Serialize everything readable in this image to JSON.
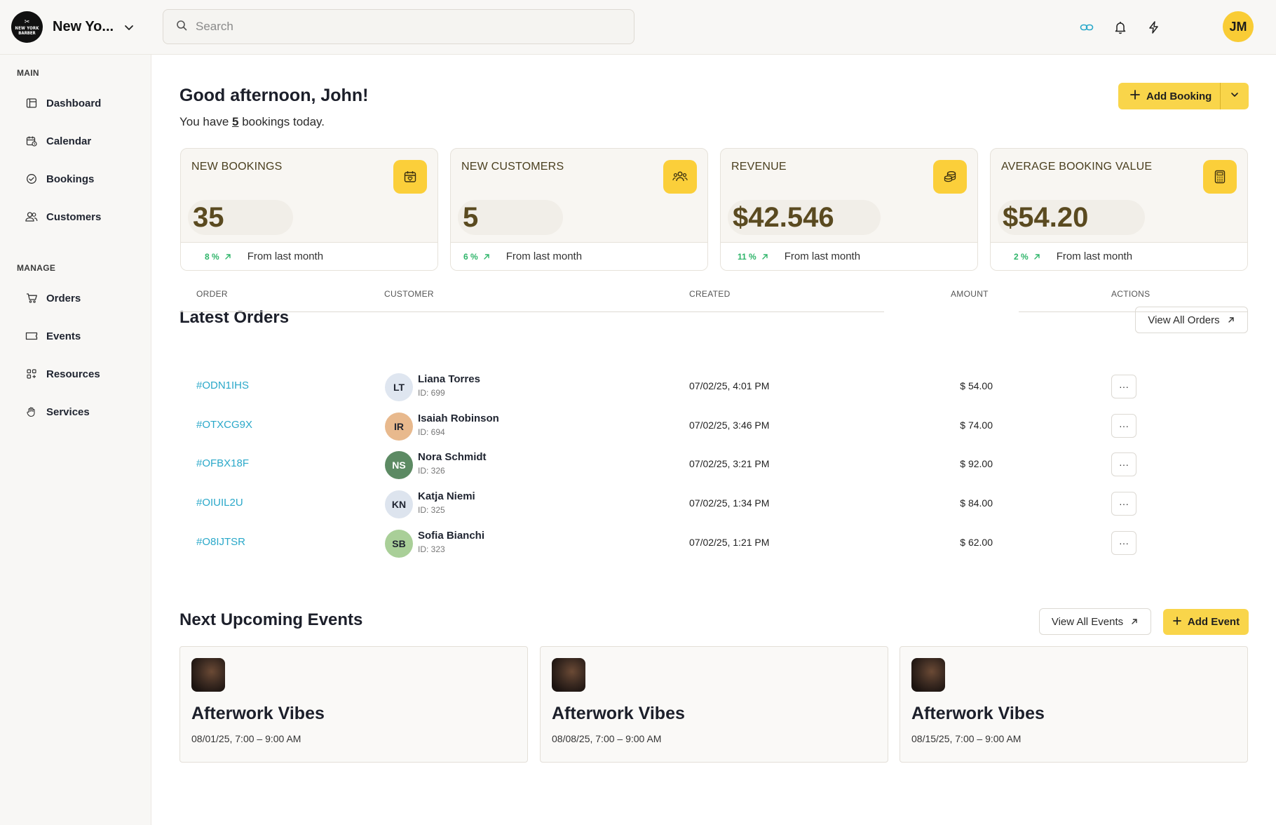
{
  "brand": {
    "name": "New Yo...",
    "logo_line1": "NEW YORK",
    "logo_line2": "BARBER"
  },
  "search": {
    "placeholder": "Search"
  },
  "user": {
    "initials": "JM"
  },
  "sidebar": {
    "main_label": "MAIN",
    "main_items": [
      {
        "label": "Dashboard",
        "icon": "dashboard-icon"
      },
      {
        "label": "Calendar",
        "icon": "calendar-icon"
      },
      {
        "label": "Bookings",
        "icon": "check-circle-icon"
      },
      {
        "label": "Customers",
        "icon": "users-icon"
      }
    ],
    "manage_label": "MANAGE",
    "manage_items": [
      {
        "label": "Orders",
        "icon": "cart-icon"
      },
      {
        "label": "Events",
        "icon": "ticket-icon"
      },
      {
        "label": "Resources",
        "icon": "grid-icon"
      },
      {
        "label": "Services",
        "icon": "hand-icon"
      }
    ]
  },
  "greeting": {
    "title": "Good afternoon, John!",
    "prefix": "You have ",
    "count": "5",
    "suffix": " bookings today."
  },
  "add_booking_label": "Add Booking",
  "stats": [
    {
      "title": "NEW BOOKINGS",
      "value": "35",
      "pct": "8 %",
      "from": "From last month",
      "icon": "calendar-heart-icon"
    },
    {
      "title": "NEW CUSTOMERS",
      "value": "5",
      "pct": "6 %",
      "from": "From last month",
      "icon": "users-icon"
    },
    {
      "title": "REVENUE",
      "value": "$42.546",
      "pct": "11 %",
      "from": "From last month",
      "icon": "coins-icon"
    },
    {
      "title": "AVERAGE BOOKING VALUE",
      "value": "$54.20",
      "pct": "2 %",
      "from": "From last month",
      "icon": "calculator-icon"
    }
  ],
  "orders": {
    "title": "Latest Orders",
    "view_all": "View All Orders",
    "columns": [
      "ORDER",
      "CUSTOMER",
      "CREATED",
      "AMOUNT",
      "ACTIONS"
    ],
    "rows": [
      {
        "id": "#ODN1IHS",
        "initials": "LT",
        "name": "Liana Torres",
        "cust_id": "ID: 699",
        "created": "07/02/25,  4:01 PM",
        "amount": "$ 54.00",
        "avatar_bg": "#dfe6f0",
        "avatar_fg": "#1f2430"
      },
      {
        "id": "#OTXCG9X",
        "initials": "IR",
        "name": "Isaiah Robinson",
        "cust_id": "ID: 694",
        "created": "07/02/25,  3:46 PM",
        "amount": "$ 74.00",
        "avatar_bg": "#e8b98d",
        "avatar_fg": "#1f2430"
      },
      {
        "id": "#OFBX18F",
        "initials": "NS",
        "name": "Nora Schmidt",
        "cust_id": "ID: 326",
        "created": "07/02/25,  3:21 PM",
        "amount": "$ 92.00",
        "avatar_bg": "#5c8a63",
        "avatar_fg": "#ffffff"
      },
      {
        "id": "#OIUIL2U",
        "initials": "KN",
        "name": "Katja Niemi",
        "cust_id": "ID: 325",
        "created": "07/02/25,  1:34 PM",
        "amount": "$ 84.00",
        "avatar_bg": "#dde4ee",
        "avatar_fg": "#1f2430"
      },
      {
        "id": "#O8IJTSR",
        "initials": "SB",
        "name": "Sofia Bianchi",
        "cust_id": "ID: 323",
        "created": "07/02/25,  1:21 PM",
        "amount": "$ 62.00",
        "avatar_bg": "#a9cf98",
        "avatar_fg": "#1f2430"
      }
    ],
    "action_label": "···"
  },
  "events": {
    "title": "Next Upcoming Events",
    "view_all": "View All Events",
    "add_label": "Add Event",
    "items": [
      {
        "title": "Afterwork Vibes",
        "date": "08/01/25, 7:00 – 9:00 AM"
      },
      {
        "title": "Afterwork Vibes",
        "date": "08/08/25, 7:00 – 9:00 AM"
      },
      {
        "title": "Afterwork Vibes",
        "date": "08/15/25, 7:00 – 9:00 AM"
      }
    ]
  },
  "colors": {
    "accent": "#f9d54a",
    "link": "#2aa8c9",
    "positive": "#2fb56a"
  }
}
